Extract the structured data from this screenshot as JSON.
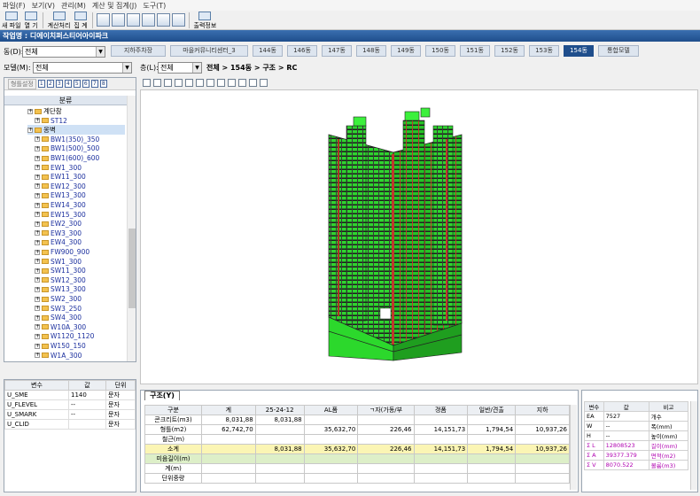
{
  "menu": [
    "파일(F)",
    "보기(V)",
    "관리(M)",
    "계산 및 집계(J)",
    "도구(T)"
  ],
  "toolbar": {
    "buttons": [
      "새 파일",
      "열 기",
      "계산처리",
      "집 계",
      "출력정보"
    ]
  },
  "work_title": "작업명 : 디에이치퍼스티어아이파크",
  "dong": {
    "label": "동(D):",
    "value": "전체"
  },
  "tabs": [
    "지하주차장",
    "마을커뮤니티센터_3",
    "144동",
    "146동",
    "147동",
    "148동",
    "149동",
    "150동",
    "151동",
    "152동",
    "153동",
    "154동",
    "통합모델"
  ],
  "active_tab": "154동",
  "model": {
    "label": "모델(M):",
    "value": "전체"
  },
  "floor": {
    "label": "층(L):",
    "value": "전체"
  },
  "breadcrumb": "전체 > 154동 > 구조 > RC",
  "left_panel": {
    "tool_label": "형틀설정",
    "numbers": [
      "1",
      "2",
      "3",
      "4",
      "5",
      "6",
      "7",
      "8"
    ],
    "header": "분류",
    "tree": [
      {
        "label": "계단참",
        "level": 0,
        "folder": true
      },
      {
        "label": "ST12",
        "level": 1
      },
      {
        "label": "옹벽",
        "level": 0,
        "folder": true,
        "selected": true
      },
      {
        "label": "BW1(350)_350",
        "level": 1
      },
      {
        "label": "BW1(500)_500",
        "level": 1
      },
      {
        "label": "BW1(600)_600",
        "level": 1
      },
      {
        "label": "EW1_300",
        "level": 1
      },
      {
        "label": "EW11_300",
        "level": 1
      },
      {
        "label": "EW12_300",
        "level": 1
      },
      {
        "label": "EW13_300",
        "level": 1
      },
      {
        "label": "EW14_300",
        "level": 1
      },
      {
        "label": "EW15_300",
        "level": 1
      },
      {
        "label": "EW2_300",
        "level": 1
      },
      {
        "label": "EW3_300",
        "level": 1
      },
      {
        "label": "EW4_300",
        "level": 1
      },
      {
        "label": "FW900_900",
        "level": 1
      },
      {
        "label": "SW1_300",
        "level": 1
      },
      {
        "label": "SW11_300",
        "level": 1
      },
      {
        "label": "SW12_300",
        "level": 1
      },
      {
        "label": "SW13_300",
        "level": 1
      },
      {
        "label": "SW2_300",
        "level": 1
      },
      {
        "label": "SW3_250",
        "level": 1
      },
      {
        "label": "SW4_300",
        "level": 1
      },
      {
        "label": "W10A_300",
        "level": 1
      },
      {
        "label": "W1120_1120",
        "level": 1
      },
      {
        "label": "W150_150",
        "level": 1
      },
      {
        "label": "W1A_300",
        "level": 1
      }
    ]
  },
  "props": {
    "headers": [
      "변수",
      "값",
      "단위"
    ],
    "rows": [
      [
        "U_SME",
        "1140",
        "문자"
      ],
      [
        "U_FLEVEL",
        "--",
        "문자"
      ],
      [
        "U_SMARK",
        "--",
        "문자"
      ],
      [
        "U_CLID",
        "",
        "문자"
      ]
    ]
  },
  "bottom": {
    "tab_label": "구조(Y)",
    "headers": [
      "구분",
      "계",
      "25-24-12",
      "AL폼",
      "ㄱ자(가동/부",
      "갱폼",
      "일반/견출",
      "지하"
    ],
    "rows": [
      {
        "cells": [
          "콘크리트(m3)",
          "8,031,88",
          "8,031,88",
          "",
          "",
          "",
          "",
          ""
        ]
      },
      {
        "cells": [
          "형틀(m2)",
          "62,742,70",
          "",
          "35,632,70",
          "226,46",
          "14,151,73",
          "1,794,54",
          "10,937,26"
        ]
      },
      {
        "cells": [
          "철근(m)",
          "",
          "",
          "",
          "",
          "",
          "",
          ""
        ]
      },
      {
        "cells": [
          "소계",
          "",
          "8,031,88",
          "35,632,70",
          "226,46",
          "14,151,73",
          "1,794,54",
          "10,937,26"
        ],
        "style": "sum"
      },
      {
        "cells": [
          "미음길이(m)",
          "",
          "",
          "",
          "",
          "",
          "",
          ""
        ],
        "style": "grn"
      },
      {
        "cells": [
          "계(m)",
          "",
          "",
          "",
          "",
          "",
          "",
          ""
        ]
      },
      {
        "cells": [
          "단위중량",
          "",
          "",
          "",
          "",
          "",
          "",
          ""
        ]
      }
    ]
  },
  "right": {
    "headers": [
      "변수",
      "값",
      "비고"
    ],
    "rows": [
      {
        "cells": [
          "EA",
          "7527",
          "개수"
        ]
      },
      {
        "cells": [
          "W",
          "--",
          "폭(mm)"
        ]
      },
      {
        "cells": [
          "H",
          "--",
          "높이(mm)"
        ]
      },
      {
        "cells": [
          "Σ L",
          "12808523",
          "길이(mm)"
        ],
        "mag": true
      },
      {
        "cells": [
          "Σ A",
          "39377.379",
          "면적(m2)"
        ],
        "mag": true
      },
      {
        "cells": [
          "Σ V",
          "8070.522",
          "볼륨(m3)"
        ],
        "mag": true
      }
    ]
  },
  "colors": {
    "title_bar": "#1f4e8c",
    "building_green": "#22dd22",
    "building_dark": "#1a1a1a",
    "building_red": "#c0392b",
    "sum_row": "#fbf5b4",
    "sigma_text": "#b000b0"
  }
}
